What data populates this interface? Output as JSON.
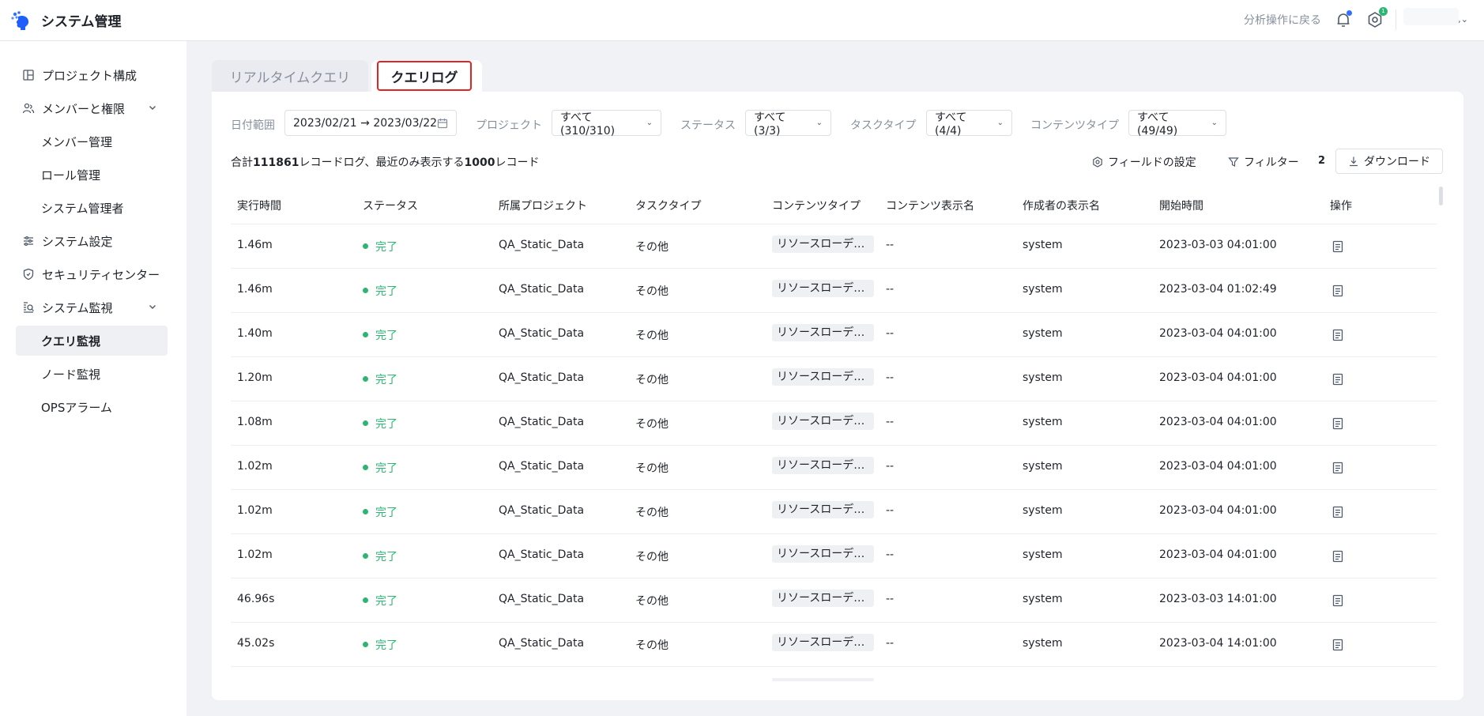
{
  "header": {
    "title": "システム管理",
    "back_link": "分析操作に戻る",
    "gear_badge": "1",
    "user_caret": ",⌄"
  },
  "sidebar": {
    "items": [
      {
        "label": "プロジェクト構成",
        "icon": "layout-icon"
      },
      {
        "label": "メンバーと権限",
        "icon": "users-icon",
        "expanded": true,
        "children": [
          "メンバー管理",
          "ロール管理",
          "システム管理者"
        ]
      },
      {
        "label": "システム設定",
        "icon": "sliders-icon"
      },
      {
        "label": "セキュリティセンター",
        "icon": "shield-icon"
      },
      {
        "label": "システム監視",
        "icon": "monitor-search-icon",
        "expanded": true,
        "children": [
          "クエリ監視",
          "ノード監視",
          "OPSアラーム"
        ],
        "active_child": "クエリ監視"
      }
    ]
  },
  "tabs": [
    {
      "label": "リアルタイムクエリ",
      "active": false
    },
    {
      "label": "クエリログ",
      "active": true
    }
  ],
  "filters": {
    "date_label": "日付範囲",
    "date_value": "2023/02/21 → 2023/03/22",
    "project_label": "プロジェクト",
    "project_value": "すべて(310/310)",
    "status_label": "ステータス",
    "status_value": "すべて(3/3)",
    "tasktype_label": "タスクタイプ",
    "tasktype_value": "すべて(4/4)",
    "contenttype_label": "コンテンツタイプ",
    "contenttype_value": "すべて(49/49)"
  },
  "summary": {
    "prefix": "合計",
    "total": "111861",
    "middle": "レコードログ、最近のみ表示する",
    "shown": "1000",
    "suffix": "レコード"
  },
  "toolbar": {
    "field_settings": "フィールドの設定",
    "filter": "フィルター",
    "filter_count": "2",
    "download": "ダウンロード"
  },
  "table": {
    "columns": [
      "実行時間",
      "ステータス",
      "所属プロジェクト",
      "タスクタイプ",
      "コンテンツタイプ",
      "コンテンツ表示名",
      "作成者の表示名",
      "開始時間",
      "操作"
    ],
    "rows": [
      {
        "exec": "1.46m",
        "status": "完了",
        "project": "QA_Static_Data",
        "task": "その他",
        "content_type": "リソースローデ…",
        "content_name": "--",
        "creator": "system",
        "start": "2023-03-03 04:01:00"
      },
      {
        "exec": "1.46m",
        "status": "完了",
        "project": "QA_Static_Data",
        "task": "その他",
        "content_type": "リソースローデ…",
        "content_name": "--",
        "creator": "system",
        "start": "2023-03-04 01:02:49"
      },
      {
        "exec": "1.40m",
        "status": "完了",
        "project": "QA_Static_Data",
        "task": "その他",
        "content_type": "リソースローデ…",
        "content_name": "--",
        "creator": "system",
        "start": "2023-03-04 04:01:00"
      },
      {
        "exec": "1.20m",
        "status": "完了",
        "project": "QA_Static_Data",
        "task": "その他",
        "content_type": "リソースローデ…",
        "content_name": "--",
        "creator": "system",
        "start": "2023-03-04 04:01:00"
      },
      {
        "exec": "1.08m",
        "status": "完了",
        "project": "QA_Static_Data",
        "task": "その他",
        "content_type": "リソースローデ…",
        "content_name": "--",
        "creator": "system",
        "start": "2023-03-04 04:01:00"
      },
      {
        "exec": "1.02m",
        "status": "完了",
        "project": "QA_Static_Data",
        "task": "その他",
        "content_type": "リソースローデ…",
        "content_name": "--",
        "creator": "system",
        "start": "2023-03-04 04:01:00"
      },
      {
        "exec": "1.02m",
        "status": "完了",
        "project": "QA_Static_Data",
        "task": "その他",
        "content_type": "リソースローデ…",
        "content_name": "--",
        "creator": "system",
        "start": "2023-03-04 04:01:00"
      },
      {
        "exec": "1.02m",
        "status": "完了",
        "project": "QA_Static_Data",
        "task": "その他",
        "content_type": "リソースローデ…",
        "content_name": "--",
        "creator": "system",
        "start": "2023-03-04 04:01:00"
      },
      {
        "exec": "46.96s",
        "status": "完了",
        "project": "QA_Static_Data",
        "task": "その他",
        "content_type": "リソースローデ…",
        "content_name": "--",
        "creator": "system",
        "start": "2023-03-03 14:01:00"
      },
      {
        "exec": "45.02s",
        "status": "完了",
        "project": "QA_Static_Data",
        "task": "その他",
        "content_type": "リソースローデ…",
        "content_name": "--",
        "creator": "system",
        "start": "2023-03-04 14:01:00"
      }
    ]
  },
  "colors": {
    "accent_blue": "#3370ff",
    "status_green": "#2bb673",
    "highlight_red": "#e02424"
  }
}
